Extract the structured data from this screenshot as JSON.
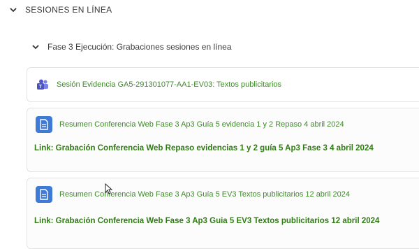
{
  "section": {
    "title": "SESIONES EN LÍNEA",
    "subsection": {
      "title": "Fase 3 Ejecución: Grabaciones sesiones en línea"
    }
  },
  "activities": [
    {
      "icon": "teams-icon",
      "title": "Sesión Evidencia GA5-291301077-AA1-EV03: Textos publicitarios"
    },
    {
      "icon": "file-icon",
      "title": "Resumen Conferencia Web Fase 3 Ap3 Guía 5 evidencia 1 y 2 Repaso 4 abril 2024",
      "link": "Link: Grabación Conferencia Web Repaso evidencias 1 y 2 guía 5 Ap3 Fase 3 4 abril 2024"
    },
    {
      "icon": "file-icon",
      "title": "Resumen Conferencia Web Fase 3 Ap3 Guía 5 EV3 Textos publicitarios 12 abril 2024",
      "link": "Link: Grabación Conferencia Web Fase 3 Ap3 Guia 5 EV3 Textos publicitarios 12 abril 2024"
    }
  ],
  "colors": {
    "link_green": "#3d8b27",
    "bold_link_green": "#2f7d12",
    "file_icon_blue": "#3f7bd6",
    "teams_purple": "#5059c9"
  }
}
